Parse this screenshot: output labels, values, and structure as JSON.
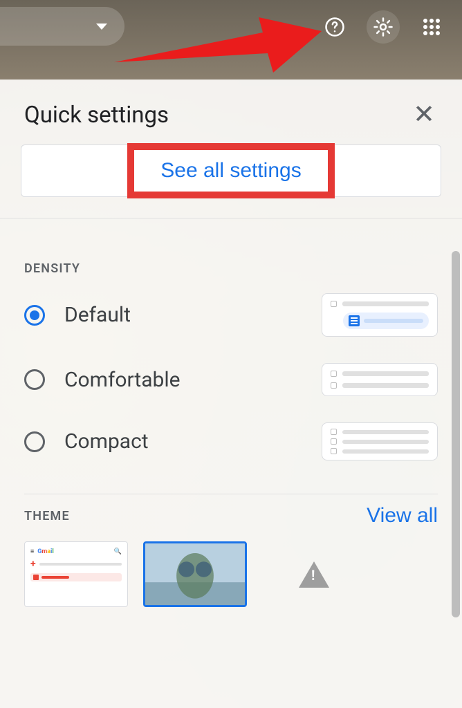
{
  "top": {
    "help_icon": "help-icon",
    "gear_icon": "gear-icon",
    "apps_icon": "apps-icon"
  },
  "panel": {
    "title": "Quick settings",
    "see_all_label": "See all settings"
  },
  "density": {
    "section_label": "DENSITY",
    "options": [
      {
        "label": "Default",
        "selected": true
      },
      {
        "label": "Comfortable",
        "selected": false
      },
      {
        "label": "Compact",
        "selected": false
      }
    ]
  },
  "theme": {
    "section_label": "THEME",
    "view_all_label": "View all",
    "thumb_gmail_label": "Gmail"
  }
}
